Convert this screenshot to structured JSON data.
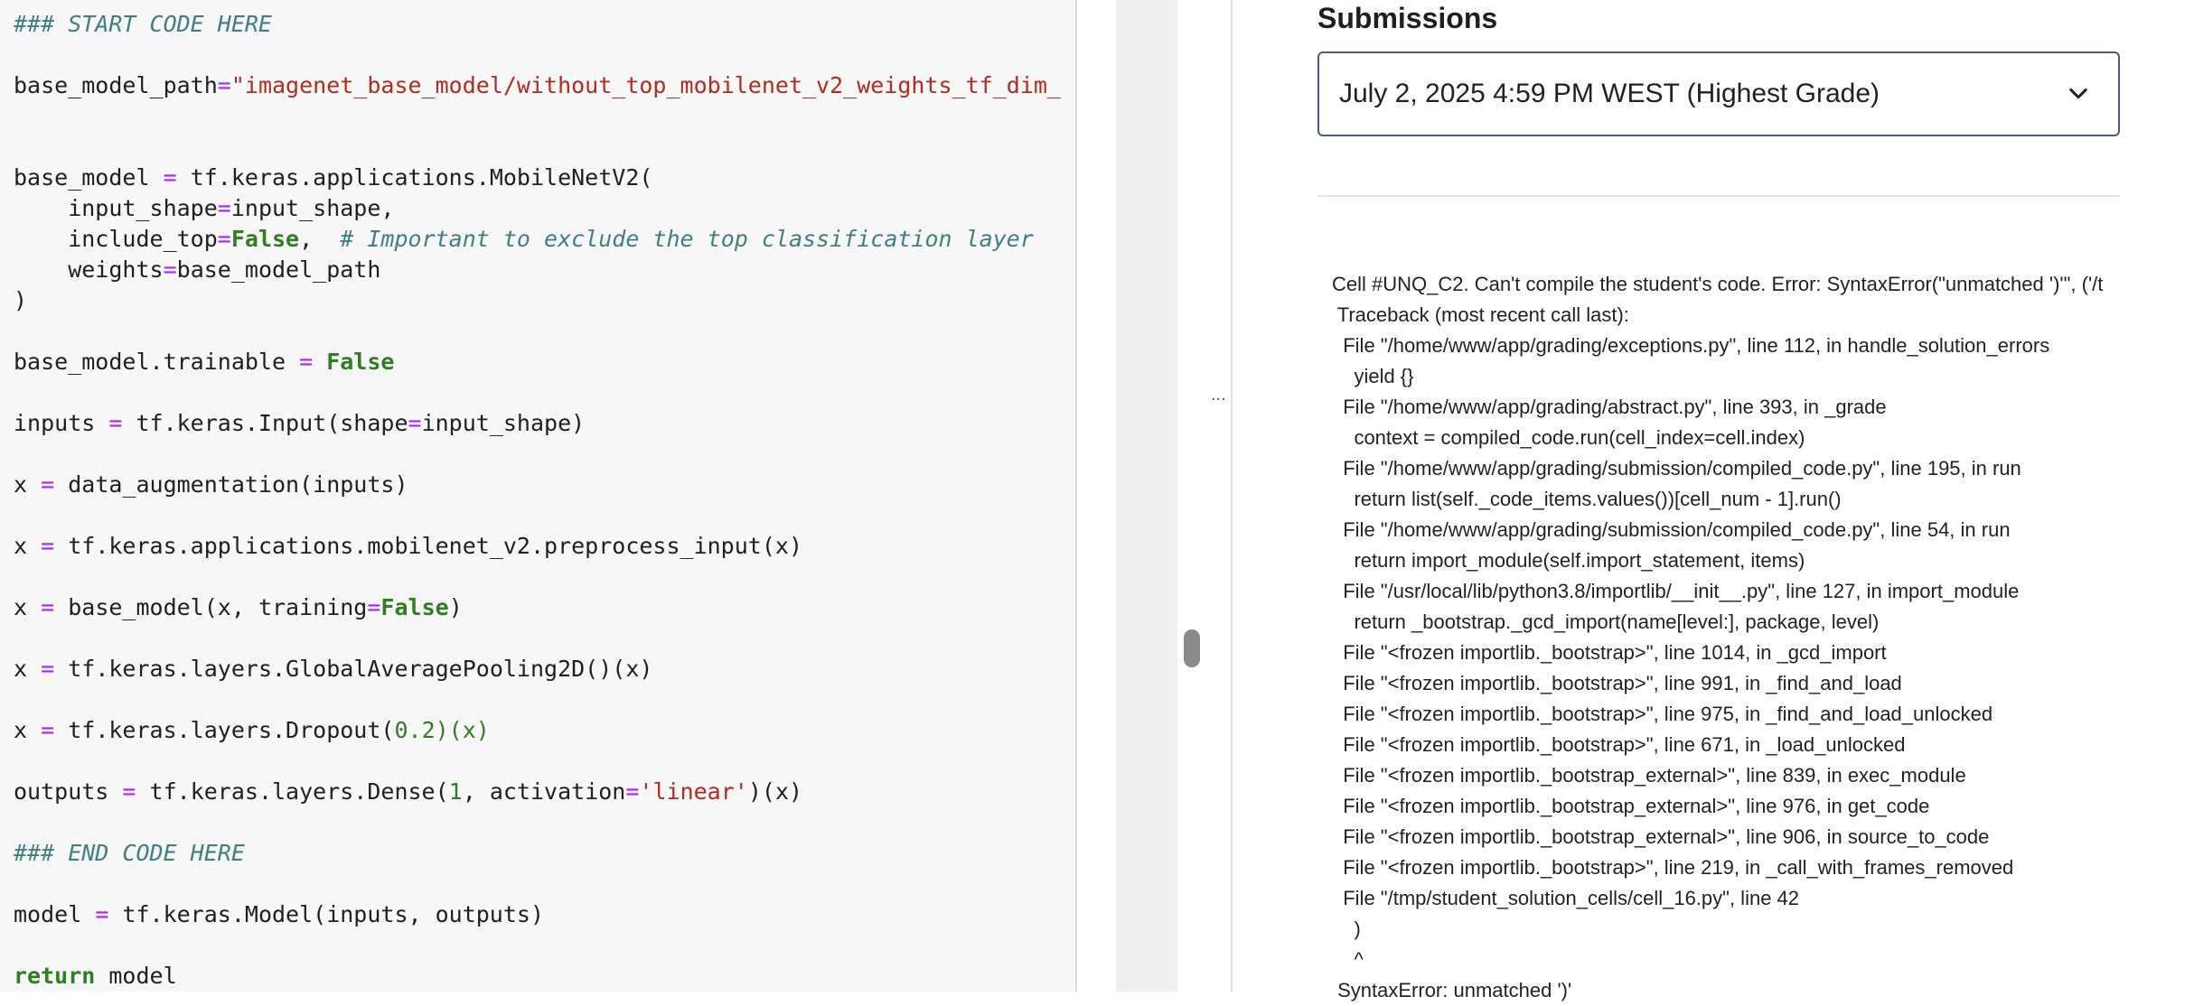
{
  "code_editor": {
    "lines": [
      [
        {
          "t": "### START CODE HERE",
          "c": "comment"
        }
      ],
      [],
      [
        {
          "t": "base_model_path"
        },
        {
          "t": "=",
          "c": "op"
        },
        {
          "t": "\"imagenet_base_model/without_top_mobilenet_v2_weights_tf_dim_",
          "c": "string"
        }
      ],
      [],
      [],
      [
        {
          "t": "base_model "
        },
        {
          "t": "=",
          "c": "op"
        },
        {
          "t": " tf.keras.applications.MobileNetV2("
        }
      ],
      [
        {
          "t": "    input_shape"
        },
        {
          "t": "=",
          "c": "op"
        },
        {
          "t": "input_shape,"
        }
      ],
      [
        {
          "t": "    include_top"
        },
        {
          "t": "=",
          "c": "op"
        },
        {
          "t": "False",
          "c": "kw"
        },
        {
          "t": ",  "
        },
        {
          "t": "# Important to exclude the top classification layer",
          "c": "comment"
        }
      ],
      [
        {
          "t": "    weights"
        },
        {
          "t": "=",
          "c": "op"
        },
        {
          "t": "base_model_path"
        }
      ],
      [
        {
          "t": ")"
        }
      ],
      [],
      [
        {
          "t": "base_model.trainable "
        },
        {
          "t": "=",
          "c": "op"
        },
        {
          "t": " "
        },
        {
          "t": "False",
          "c": "kw"
        }
      ],
      [],
      [
        {
          "t": "inputs "
        },
        {
          "t": "=",
          "c": "op"
        },
        {
          "t": " tf.keras.Input(shape"
        },
        {
          "t": "=",
          "c": "op"
        },
        {
          "t": "input_shape)"
        }
      ],
      [],
      [
        {
          "t": "x "
        },
        {
          "t": "=",
          "c": "op"
        },
        {
          "t": " data_augmentation(inputs)"
        }
      ],
      [],
      [
        {
          "t": "x "
        },
        {
          "t": "=",
          "c": "op"
        },
        {
          "t": " tf.keras.applications.mobilenet_v2.preprocess_input(x)"
        }
      ],
      [],
      [
        {
          "t": "x "
        },
        {
          "t": "=",
          "c": "op"
        },
        {
          "t": " base_model(x, training"
        },
        {
          "t": "=",
          "c": "op"
        },
        {
          "t": "False",
          "c": "kw"
        },
        {
          "t": ")"
        }
      ],
      [],
      [
        {
          "t": "x "
        },
        {
          "t": "=",
          "c": "op"
        },
        {
          "t": " tf.keras.layers.GlobalAveragePooling2D()(x)"
        }
      ],
      [],
      [
        {
          "t": "x "
        },
        {
          "t": "=",
          "c": "op"
        },
        {
          "t": " tf.keras.layers.Dropout("
        },
        {
          "t": "0.2",
          "c": "num"
        },
        {
          "t": ")(x)",
          "c": "num"
        }
      ],
      [],
      [
        {
          "t": "outputs "
        },
        {
          "t": "=",
          "c": "op"
        },
        {
          "t": " tf.keras.layers.Dense("
        },
        {
          "t": "1",
          "c": "num"
        },
        {
          "t": ", activation"
        },
        {
          "t": "=",
          "c": "op"
        },
        {
          "t": "'linear'",
          "c": "string"
        },
        {
          "t": ")(x)"
        }
      ],
      [],
      [
        {
          "t": "### END CODE HERE",
          "c": "comment"
        }
      ],
      [],
      [
        {
          "t": "model "
        },
        {
          "t": "=",
          "c": "op"
        },
        {
          "t": " tf.keras.Model(inputs, outputs)"
        }
      ],
      [],
      [
        {
          "t": "return",
          "c": "kw"
        },
        {
          "t": " model"
        }
      ]
    ]
  },
  "gutter": {
    "ellipsis": "..."
  },
  "submissions": {
    "title": "Submissions",
    "selected": "July 2, 2025 4:59 PM WEST (Highest Grade)",
    "chevron_icon": "chevron-down-icon"
  },
  "grader_output": {
    "lines": [
      "Cell #UNQ_C2. Can't compile the student's code. Error: SyntaxError(\"unmatched ')'\", ('/t",
      " Traceback (most recent call last):",
      "  File \"/home/www/app/grading/exceptions.py\", line 112, in handle_solution_errors",
      "    yield {}",
      "  File \"/home/www/app/grading/abstract.py\", line 393, in _grade",
      "    context = compiled_code.run(cell_index=cell.index)",
      "  File \"/home/www/app/grading/submission/compiled_code.py\", line 195, in run",
      "    return list(self._code_items.values())[cell_num - 1].run()",
      "  File \"/home/www/app/grading/submission/compiled_code.py\", line 54, in run",
      "    return import_module(self.import_statement, items)",
      "  File \"/usr/local/lib/python3.8/importlib/__init__.py\", line 127, in import_module",
      "    return _bootstrap._gcd_import(name[level:], package, level)",
      "  File \"<frozen importlib._bootstrap>\", line 1014, in _gcd_import",
      "  File \"<frozen importlib._bootstrap>\", line 991, in _find_and_load",
      "  File \"<frozen importlib._bootstrap>\", line 975, in _find_and_load_unlocked",
      "  File \"<frozen importlib._bootstrap>\", line 671, in _load_unlocked",
      "  File \"<frozen importlib._bootstrap_external>\", line 839, in exec_module",
      "  File \"<frozen importlib._bootstrap_external>\", line 976, in get_code",
      "  File \"<frozen importlib._bootstrap_external>\", line 906, in source_to_code",
      "  File \"<frozen importlib._bootstrap>\", line 219, in _call_with_frames_removed",
      "  File \"/tmp/student_solution_cells/cell_16.py\", line 42",
      "    )",
      "    ^",
      " SyntaxError: unmatched ')'"
    ]
  }
}
